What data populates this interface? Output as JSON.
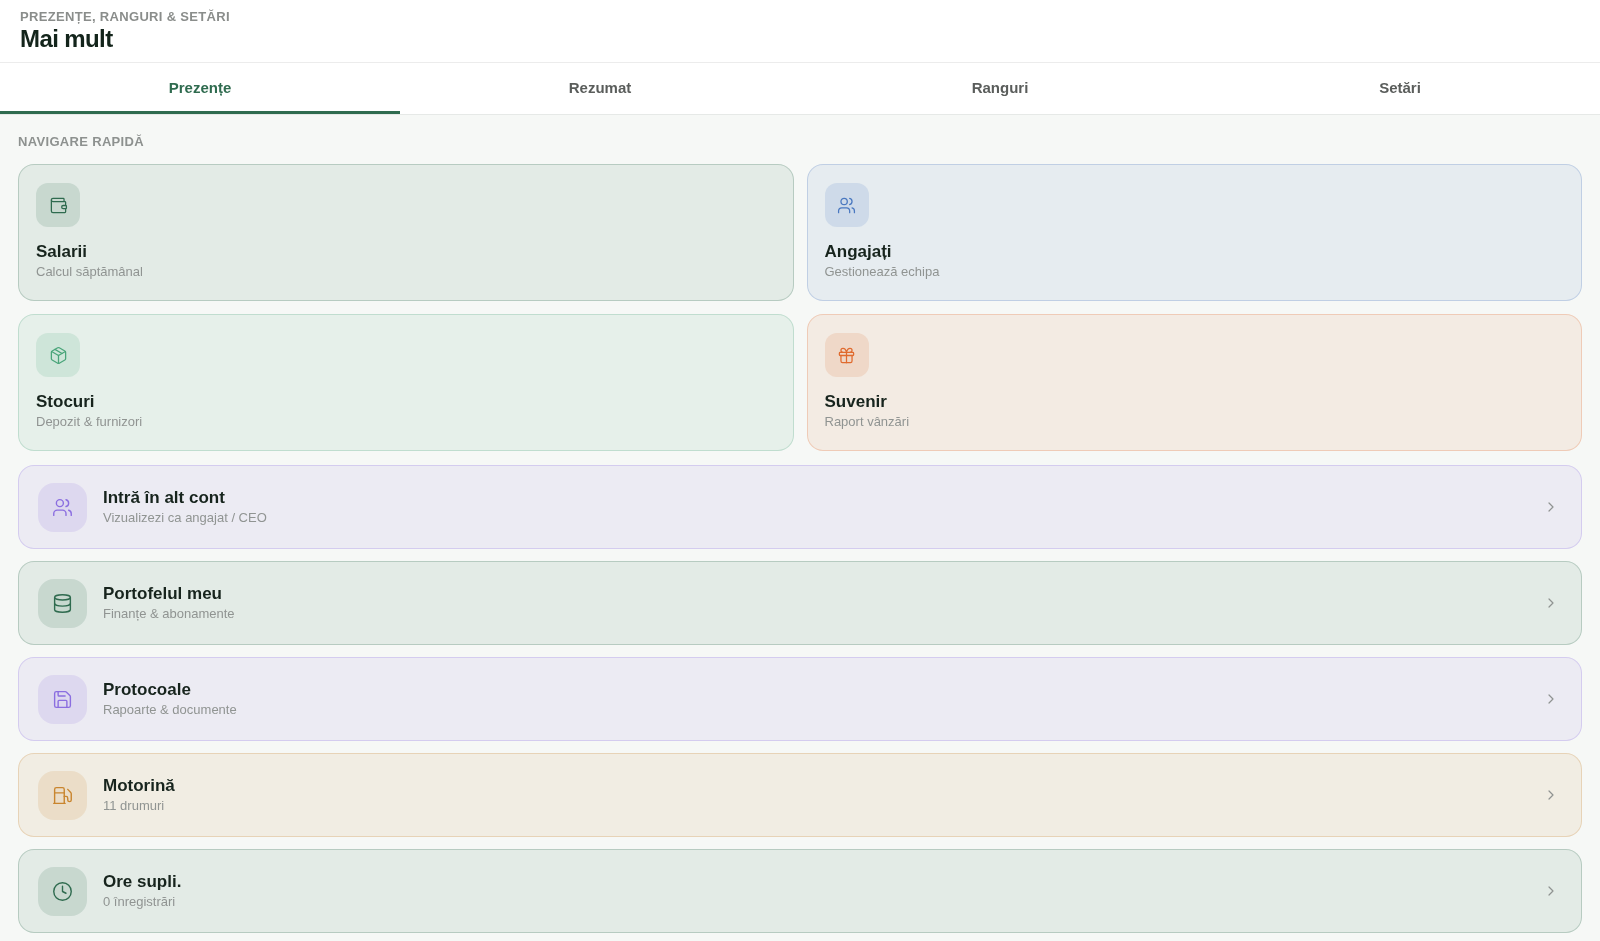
{
  "header": {
    "eyebrow": "PREZENȚE, RANGURI & SETĂRI",
    "title": "Mai mult"
  },
  "tabs": [
    {
      "label": "Prezențe",
      "selected": true
    },
    {
      "label": "Rezumat",
      "selected": false
    },
    {
      "label": "Ranguri",
      "selected": false
    },
    {
      "label": "Setări",
      "selected": false
    }
  ],
  "section_label": "NAVIGARE RAPIDĂ",
  "quick_tiles": [
    {
      "title": "Salarii",
      "subtitle": "Calcul săptămânal",
      "color": "#2f6b4f"
    },
    {
      "title": "Angajați",
      "subtitle": "Gestionează echipa",
      "color": "#4a78c0"
    },
    {
      "title": "Stocuri",
      "subtitle": "Depozit & furnizori",
      "color": "#4aa57a"
    },
    {
      "title": "Suvenir",
      "subtitle": "Raport vânzări",
      "color": "#e06b2f"
    }
  ],
  "links": [
    {
      "title": "Intră în alt cont",
      "subtitle": "Vizualizezi ca angajat / CEO",
      "color": "#8b6ee0"
    },
    {
      "title": "Portofelul meu",
      "subtitle": "Finanțe & abonamente",
      "color": "#2f6b4f"
    },
    {
      "title": "Protocoale",
      "subtitle": "Rapoarte & documente",
      "color": "#8b6ee0"
    },
    {
      "title": "Motorină",
      "subtitle": "11 drumuri",
      "color": "#c9852e"
    },
    {
      "title": "Ore supli.",
      "subtitle": "0 înregistrări",
      "color": "#2f6b4f"
    }
  ]
}
